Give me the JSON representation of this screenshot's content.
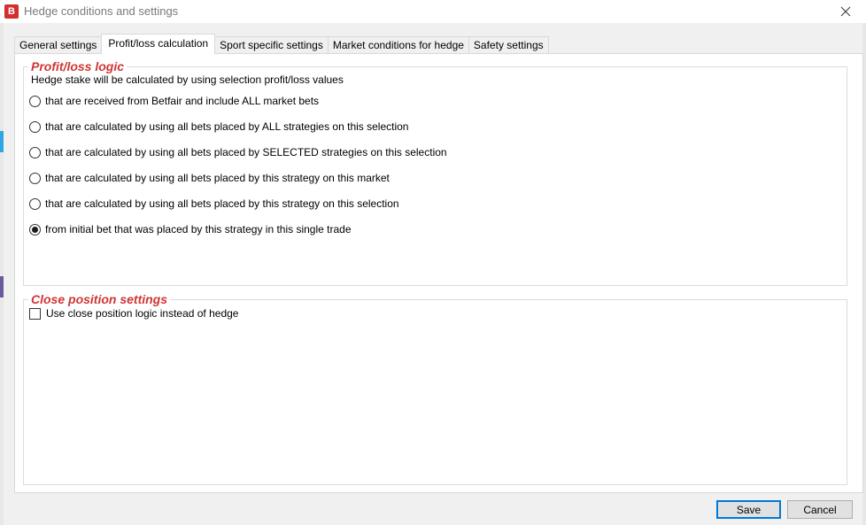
{
  "window": {
    "app_icon_letter": "B",
    "title": "Hedge conditions and settings",
    "close_glyph": "×"
  },
  "tabs": [
    {
      "label": "General settings",
      "active": false
    },
    {
      "label": "Profit/loss calculation",
      "active": true
    },
    {
      "label": "Sport specific settings",
      "active": false
    },
    {
      "label": "Market conditions for hedge",
      "active": false
    },
    {
      "label": "Safety settings",
      "active": false
    }
  ],
  "profit_loss_logic": {
    "legend": "Profit/loss logic",
    "description": "Hedge stake will be calculated by using selection profit/loss values",
    "options": [
      {
        "label": "that are received from Betfair and include ALL market bets",
        "selected": false
      },
      {
        "label": "that are calculated by using all bets placed by ALL strategies on this selection",
        "selected": false
      },
      {
        "label": "that are calculated by using all bets placed by SELECTED strategies on this selection",
        "selected": false
      },
      {
        "label": "that are calculated by using all bets placed by this strategy on this market",
        "selected": false
      },
      {
        "label": "that are calculated by using all bets placed by this strategy on this selection",
        "selected": false
      },
      {
        "label": "from initial bet that was placed by this strategy in this single trade",
        "selected": true
      }
    ]
  },
  "close_position": {
    "legend": "Close position settings",
    "checkbox_label": "Use close position logic instead of hedge",
    "checked": false
  },
  "buttons": {
    "save": "Save",
    "cancel": "Cancel"
  },
  "colors": {
    "legend": "#d03434",
    "default_button_border": "#0078d7",
    "app_icon": "#d32f2f"
  }
}
